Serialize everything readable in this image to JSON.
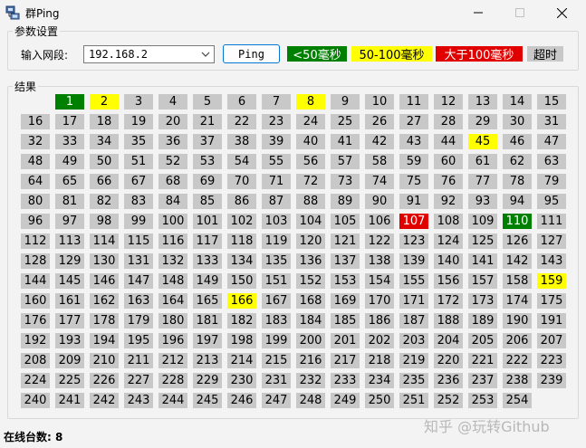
{
  "window": {
    "title": "群Ping",
    "icons": {
      "app": "network-icon",
      "minimize": "minimize-icon",
      "maximize": "maximize-icon",
      "close": "close-icon"
    }
  },
  "params": {
    "group_label": "参数设置",
    "segment_label": "输入网段:",
    "segment_value": "192.168.2",
    "ping_button": "Ping",
    "legend": [
      {
        "label": "<50毫秒",
        "bg": "#008000",
        "fg": "#ffffff"
      },
      {
        "label": "50-100毫秒",
        "bg": "#ffff00",
        "fg": "#000000"
      },
      {
        "label": "大于100毫秒",
        "bg": "#e00000",
        "fg": "#ffffff"
      },
      {
        "label": "超时",
        "bg": "#c8c8c8",
        "fg": "#000000"
      }
    ]
  },
  "results": {
    "group_label": "结果",
    "hosts": [
      "1",
      "2",
      "3",
      "4",
      "5",
      "6",
      "7",
      "8",
      "9",
      "10",
      "11",
      "12",
      "13",
      "14",
      "15",
      "16",
      "17",
      "18",
      "19",
      "20",
      "21",
      "22",
      "23",
      "24",
      "25",
      "26",
      "27",
      "28",
      "29",
      "30",
      "31",
      "32",
      "33",
      "34",
      "35",
      "36",
      "37",
      "38",
      "39",
      "40",
      "41",
      "42",
      "43",
      "44",
      "45",
      "46",
      "47",
      "48",
      "49",
      "50",
      "51",
      "52",
      "53",
      "54",
      "55",
      "56",
      "57",
      "58",
      "59",
      "60",
      "61",
      "62",
      "63",
      "64",
      "65",
      "66",
      "67",
      "68",
      "69",
      "70",
      "71",
      "72",
      "73",
      "74",
      "75",
      "76",
      "77",
      "78",
      "79",
      "80",
      "81",
      "82",
      "83",
      "84",
      "85",
      "86",
      "87",
      "88",
      "89",
      "90",
      "91",
      "92",
      "93",
      "94",
      "95",
      "96",
      "97",
      "98",
      "99",
      "100",
      "101",
      "102",
      "103",
      "104",
      "105",
      "106",
      "107",
      "108",
      "109",
      "110",
      "111",
      "112",
      "113",
      "114",
      "115",
      "116",
      "117",
      "118",
      "119",
      "120",
      "121",
      "122",
      "123",
      "124",
      "125",
      "126",
      "127",
      "128",
      "129",
      "130",
      "131",
      "132",
      "133",
      "134",
      "135",
      "136",
      "137",
      "138",
      "139",
      "140",
      "141",
      "142",
      "143",
      "144",
      "145",
      "146",
      "147",
      "148",
      "149",
      "150",
      "151",
      "152",
      "153",
      "154",
      "155",
      "156",
      "157",
      "158",
      "159",
      "160",
      "161",
      "162",
      "163",
      "164",
      "165",
      "166",
      "167",
      "168",
      "169",
      "170",
      "171",
      "172",
      "173",
      "174",
      "175",
      "176",
      "177",
      "178",
      "179",
      "180",
      "181",
      "182",
      "183",
      "184",
      "185",
      "186",
      "187",
      "188",
      "189",
      "190",
      "191",
      "192",
      "193",
      "194",
      "195",
      "196",
      "197",
      "198",
      "199",
      "200",
      "201",
      "202",
      "203",
      "204",
      "205",
      "206",
      "207",
      "208",
      "209",
      "210",
      "211",
      "212",
      "213",
      "214",
      "215",
      "216",
      "217",
      "218",
      "219",
      "220",
      "221",
      "222",
      "223",
      "224",
      "225",
      "226",
      "227",
      "228",
      "229",
      "230",
      "231",
      "232",
      "233",
      "234",
      "235",
      "236",
      "237",
      "238",
      "239",
      "240",
      "241",
      "242",
      "243",
      "244",
      "245",
      "246",
      "247",
      "248",
      "249",
      "250",
      "251",
      "252",
      "253",
      "254"
    ],
    "status": {
      "1": "green",
      "2": "yellow",
      "8": "yellow",
      "45": "yellow",
      "107": "red",
      "110": "green",
      "159": "yellow",
      "166": "yellow"
    }
  },
  "statusbar": {
    "online_label": "在线台数:",
    "online_count": "8"
  },
  "watermark": "知乎 @玩转Github"
}
